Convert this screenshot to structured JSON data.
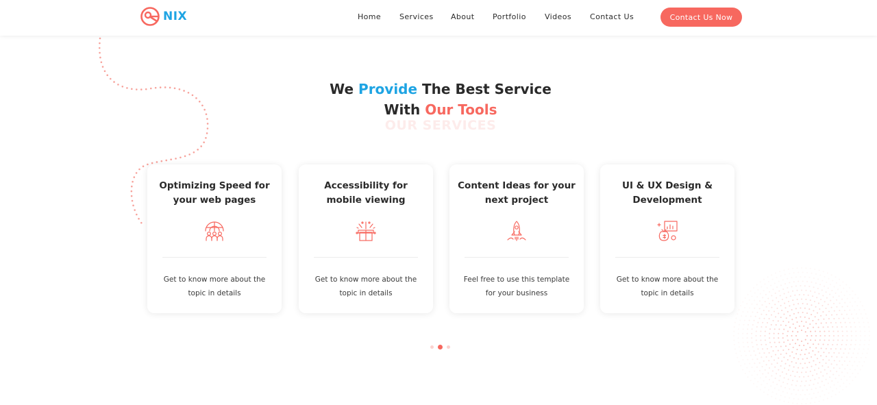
{
  "brand": {
    "name": "NIX"
  },
  "nav": {
    "items": [
      {
        "label": "Home"
      },
      {
        "label": "Services"
      },
      {
        "label": "About"
      },
      {
        "label": "Portfolio"
      },
      {
        "label": "Videos"
      },
      {
        "label": "Contact Us"
      }
    ],
    "cta_label": "Contact Us Now"
  },
  "section": {
    "heading_line1": {
      "part1": "We ",
      "part2": "Provide",
      "part3": " The Best Service"
    },
    "heading_line2": {
      "part1": "With ",
      "part2": "Our Tools"
    },
    "ghost_label": "OUR SERVICES"
  },
  "cards": [
    {
      "title_line1": "Optimizing Speed for",
      "title_line2": "your web pages",
      "icon": "globe-team-icon",
      "text_line1": "Get to know more about the",
      "text_line2": "topic in details"
    },
    {
      "title_line1": "Accessibility for",
      "title_line2": "mobile viewing",
      "icon": "gift-box-icon",
      "text_line1": "Get to know more about the",
      "text_line2": "topic in details"
    },
    {
      "title_line1": "Content Ideas for your",
      "title_line2": "next project",
      "icon": "rocket-icon",
      "text_line1": "Feel free to use this template",
      "text_line2": "for your business"
    },
    {
      "title_line1": "UI & UX Design &",
      "title_line2": "Development",
      "icon": "analytics-icon",
      "text_line1": "Get to know more about the",
      "text_line2": "topic in details"
    }
  ],
  "pagination": {
    "pages": 3,
    "active": 2
  },
  "colors": {
    "accent": "#f7685f",
    "brand_blue": "#1ea4e3",
    "text": "#2a2a2a"
  }
}
